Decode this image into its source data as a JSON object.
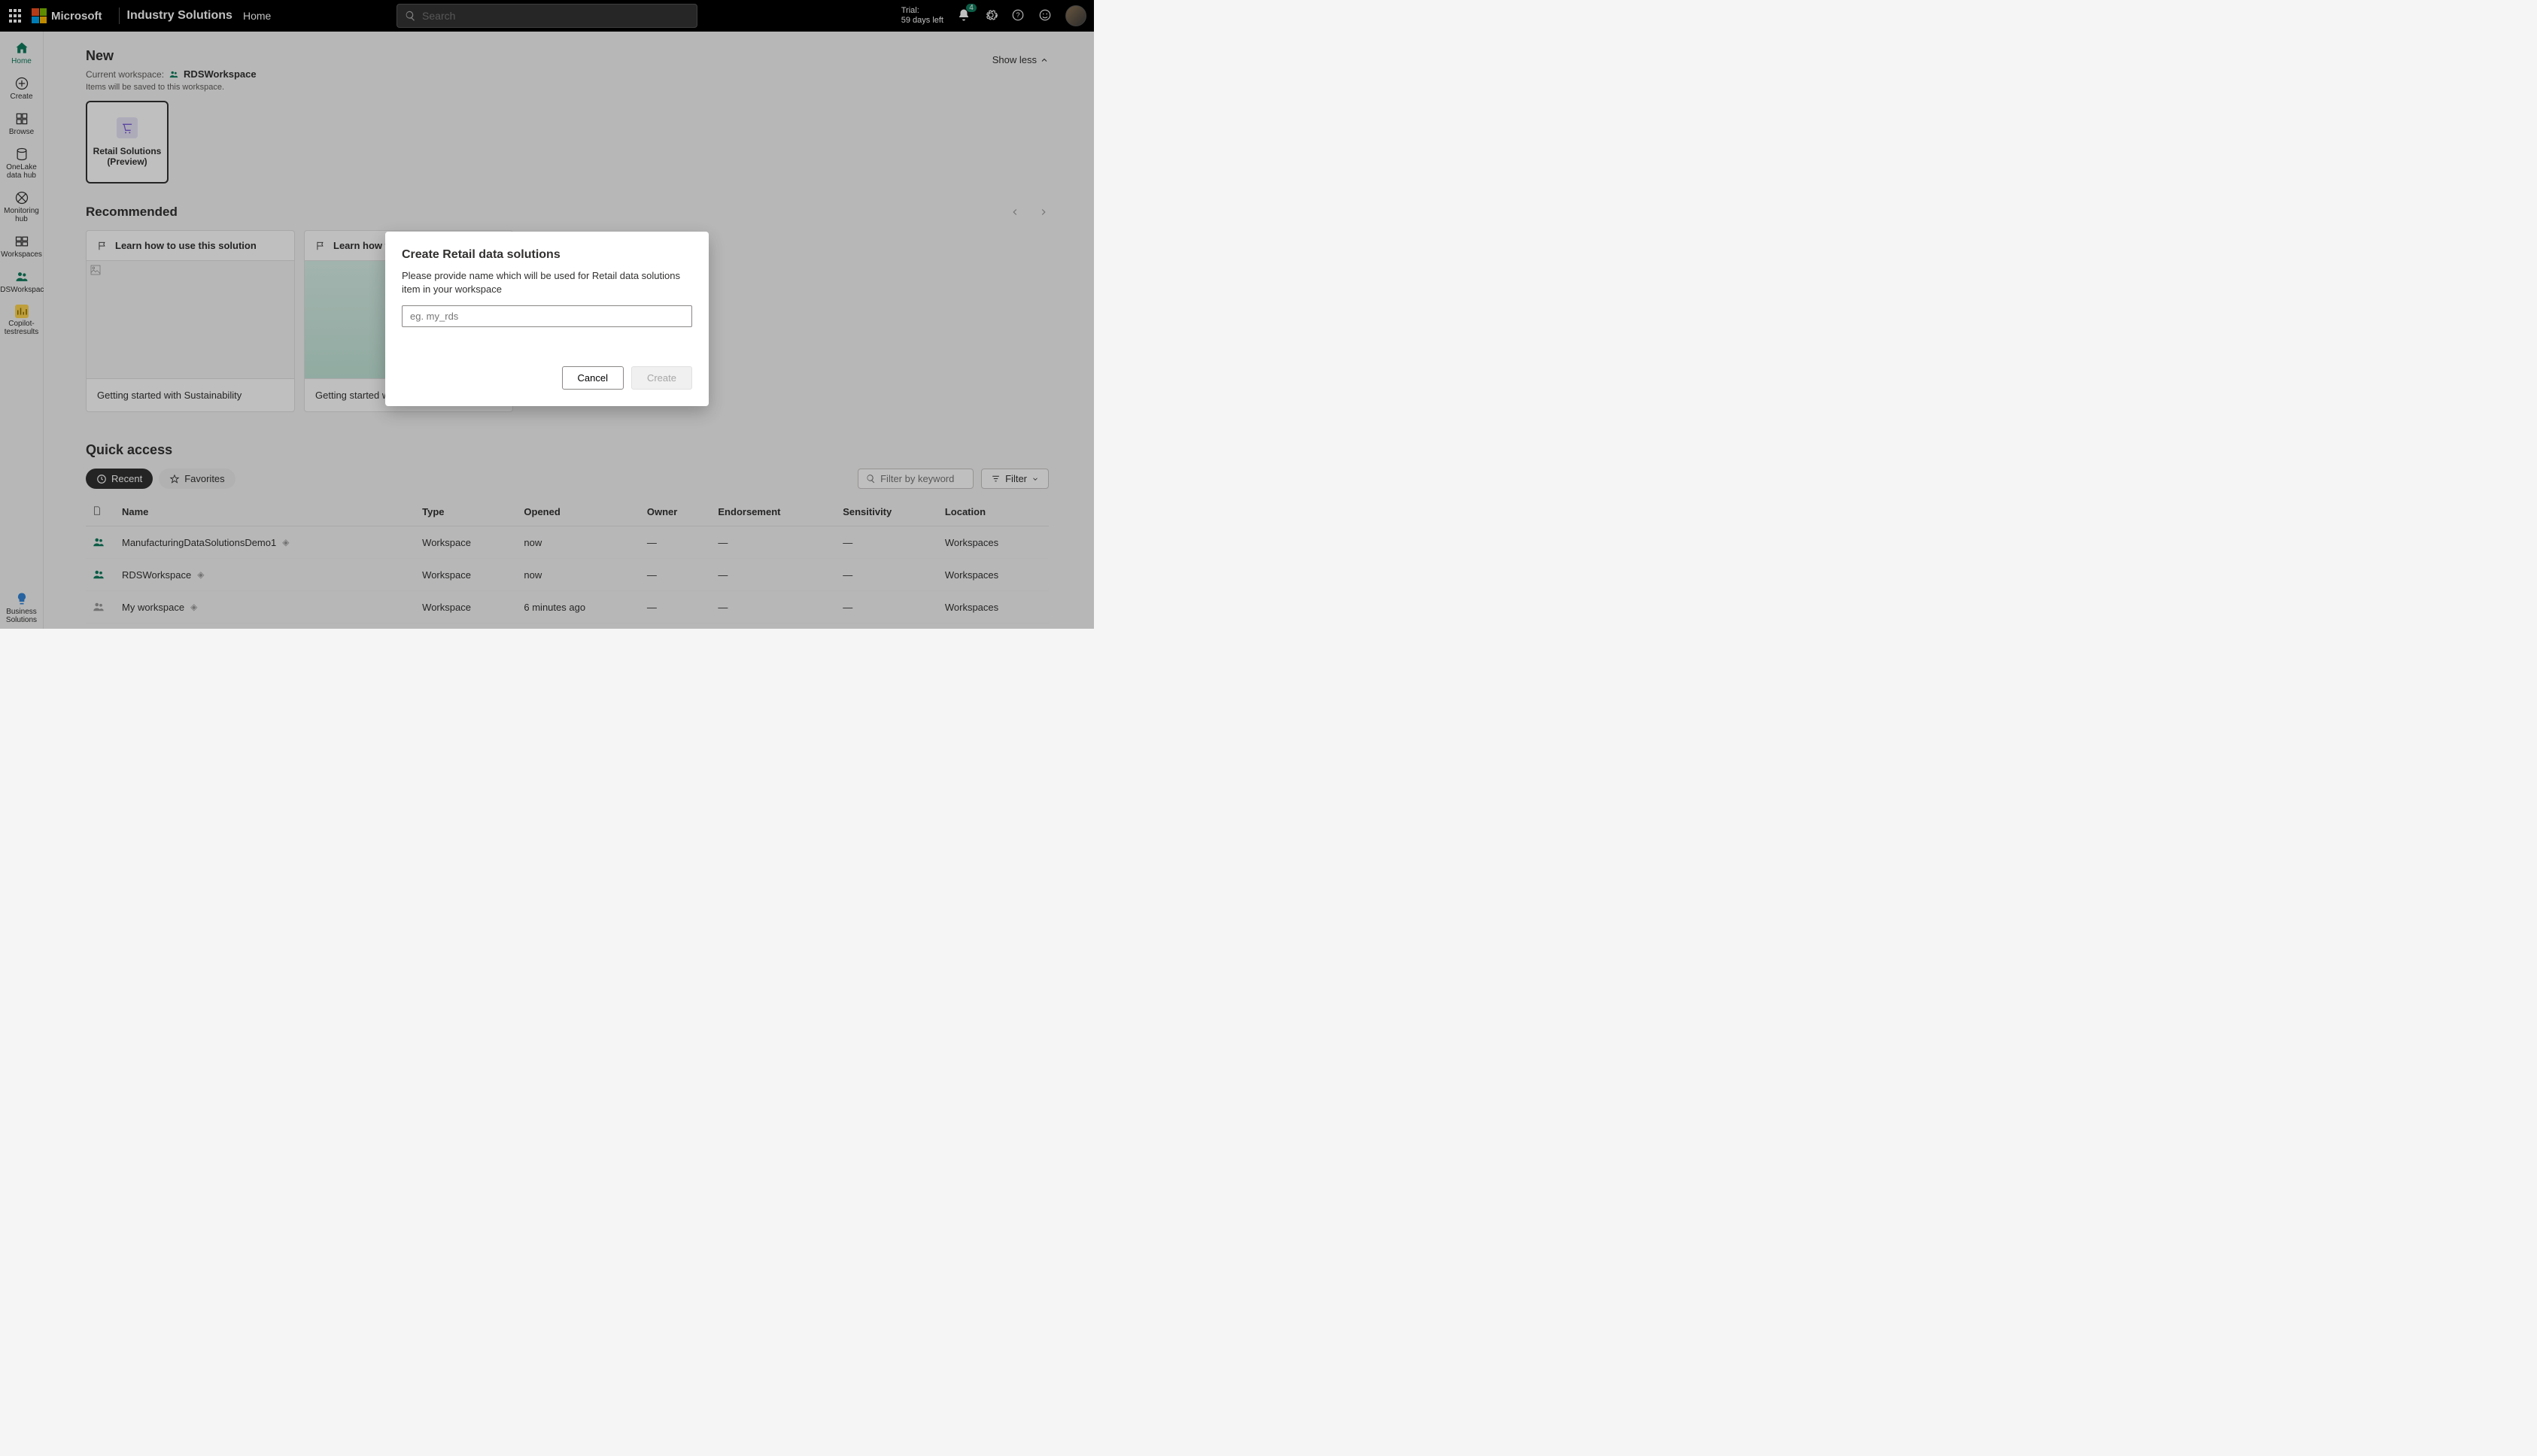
{
  "topbar": {
    "microsoft": "Microsoft",
    "product": "Industry Solutions",
    "home": "Home",
    "search_placeholder": "Search",
    "trial_label": "Trial:",
    "trial_days": "59 days left",
    "notif_count": "4"
  },
  "leftnav": {
    "home": "Home",
    "create": "Create",
    "browse": "Browse",
    "onelake": "OneLake data hub",
    "monitoring": "Monitoring hub",
    "workspaces": "Workspaces",
    "rds": "RDSWorkspace",
    "copilot": "Copilot-testresults",
    "business": "Business Solutions"
  },
  "new": {
    "title": "New",
    "current_label": "Current workspace:",
    "workspace_name": "RDSWorkspace",
    "show_less": "Show less",
    "save_note": "Items will be saved to this workspace.",
    "tile_label": "Retail Solutions (Preview)"
  },
  "recommended": {
    "title": "Recommended",
    "cards": [
      {
        "head": "Learn how to use this solution",
        "foot": "Getting started with Sustainability"
      },
      {
        "head": "Learn how to use this solution",
        "foot": "Getting started with Retail"
      }
    ]
  },
  "quick": {
    "title": "Quick access",
    "recent": "Recent",
    "favorites": "Favorites",
    "filter_placeholder": "Filter by keyword",
    "filter_label": "Filter",
    "cols": {
      "name": "Name",
      "type": "Type",
      "opened": "Opened",
      "owner": "Owner",
      "endorsement": "Endorsement",
      "sensitivity": "Sensitivity",
      "location": "Location"
    },
    "rows": [
      {
        "name": "ManufacturingDataSolutionsDemo1",
        "type": "Workspace",
        "opened": "now",
        "owner": "—",
        "endorsement": "—",
        "sensitivity": "—",
        "location": "Workspaces",
        "icon": "green"
      },
      {
        "name": "RDSWorkspace",
        "type": "Workspace",
        "opened": "now",
        "owner": "—",
        "endorsement": "—",
        "sensitivity": "—",
        "location": "Workspaces",
        "icon": "green"
      },
      {
        "name": "My workspace",
        "type": "Workspace",
        "opened": "6 minutes ago",
        "owner": "—",
        "endorsement": "—",
        "sensitivity": "—",
        "location": "Workspaces",
        "icon": "grey"
      }
    ]
  },
  "dialog": {
    "title": "Create Retail data solutions",
    "desc": "Please provide name which will be used for Retail data solutions item in your workspace",
    "placeholder": "eg. my_rds",
    "cancel": "Cancel",
    "create": "Create"
  }
}
